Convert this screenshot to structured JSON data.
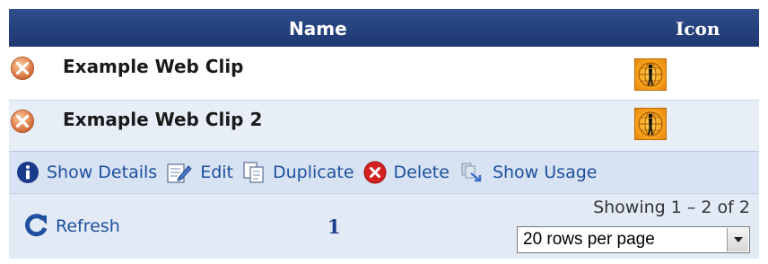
{
  "header": {
    "name_col": "Name",
    "icon_col": "Icon"
  },
  "rows": [
    {
      "name": "Example Web Clip",
      "row_icon": "delete-circle-icon",
      "thumb_icon": "globe-person-icon"
    },
    {
      "name": "Exmaple Web Clip 2",
      "row_icon": "delete-circle-icon",
      "thumb_icon": "globe-person-icon"
    }
  ],
  "toolbar": {
    "show_details": "Show Details",
    "edit": "Edit",
    "duplicate": "Duplicate",
    "delete": "Delete",
    "show_usage": "Show Usage"
  },
  "footer": {
    "refresh": "Refresh",
    "page": "1",
    "showing": "Showing 1 – 2 of 2",
    "rows_per_page": "20 rows per page"
  },
  "colors": {
    "header_bg": "#1d3670",
    "link": "#1f4f9f",
    "toolbar_bg": "#d7e2f2",
    "row_alt_bg": "#e7eef8"
  }
}
